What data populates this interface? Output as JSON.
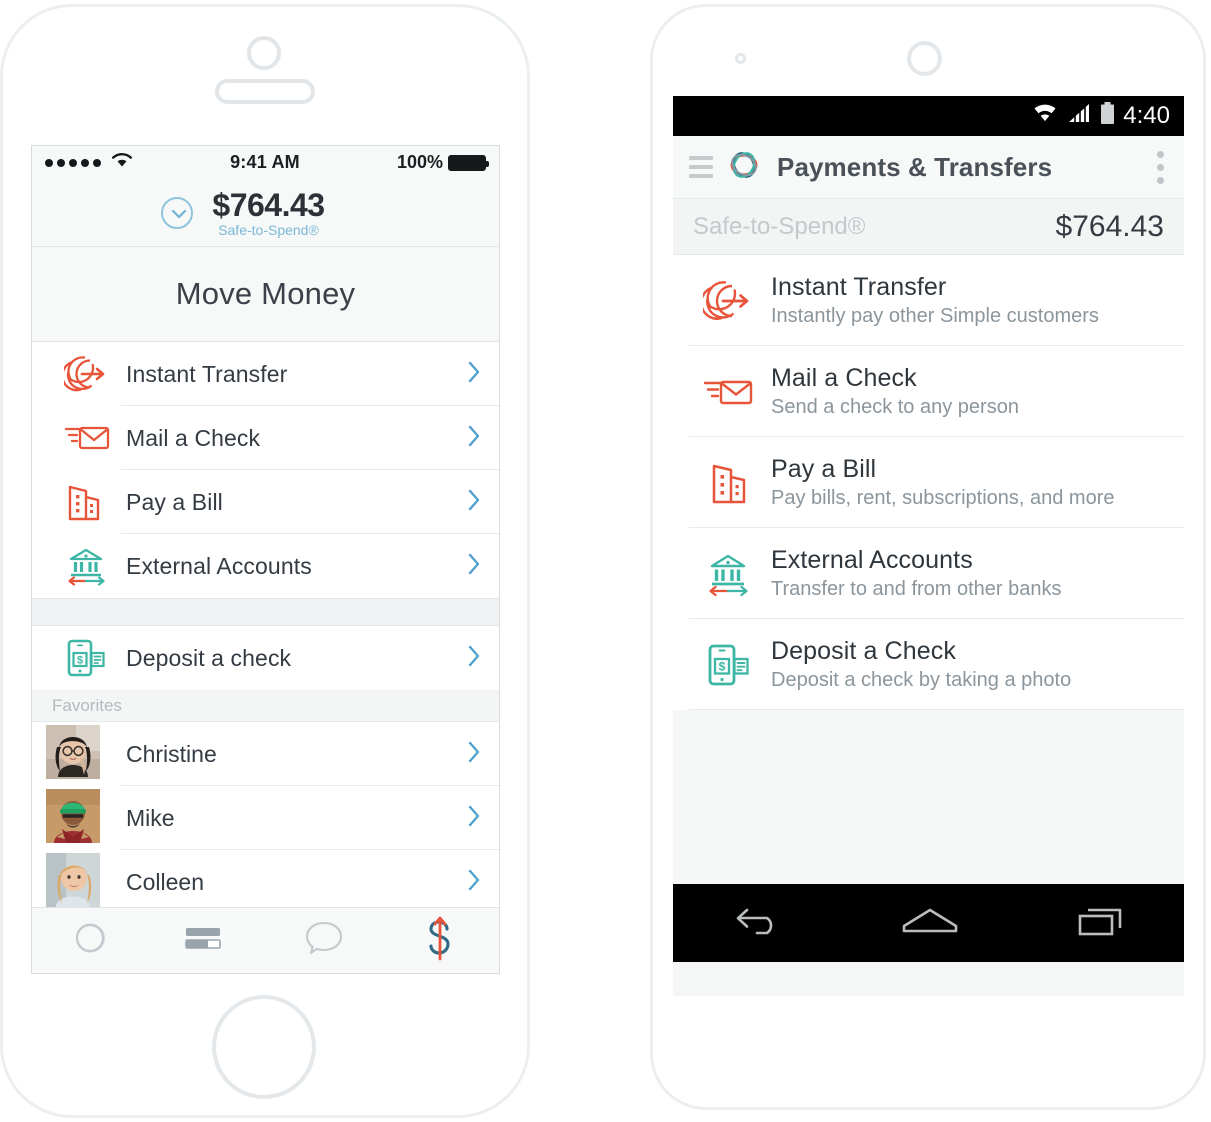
{
  "ios": {
    "status_bar": {
      "signal_dots": 5,
      "wifi_icon": "wifi-icon",
      "time": "9:41 AM",
      "battery_percent": "100%",
      "battery_icon": "battery-full-icon"
    },
    "safe_to_spend": {
      "amount": "$764.43",
      "label": "Safe-to-Spend®",
      "expand_icon": "chevron-down-circle-icon"
    },
    "nav_title": "Move Money",
    "primary_items": [
      {
        "label": "Instant Transfer",
        "icon": "instant-transfer-icon"
      },
      {
        "label": "Mail a Check",
        "icon": "envelope-icon"
      },
      {
        "label": "Pay a Bill",
        "icon": "buildings-icon"
      },
      {
        "label": "External Accounts",
        "icon": "bank-transfer-icon"
      }
    ],
    "secondary_items": [
      {
        "label": "Deposit a check",
        "icon": "phone-check-icon"
      }
    ],
    "favorites_header": "Favorites",
    "favorites": [
      {
        "name": "Christine",
        "avatar": "avatar-christine"
      },
      {
        "name": "Mike",
        "avatar": "avatar-mike"
      },
      {
        "name": "Colleen",
        "avatar": "avatar-colleen"
      }
    ],
    "tabs": [
      {
        "name": "home",
        "icon": "simple-logo-icon",
        "active": false
      },
      {
        "name": "goals",
        "icon": "goals-bars-icon",
        "active": false
      },
      {
        "name": "messages",
        "icon": "speech-bubble-icon",
        "active": false
      },
      {
        "name": "move-money",
        "icon": "dollar-arrow-icon",
        "active": true
      }
    ],
    "chevron_icon": "chevron-right-icon"
  },
  "android": {
    "status_bar": {
      "wifi_icon": "wifi-icon",
      "signal_icon": "cell-signal-icon",
      "battery_icon": "battery-icon",
      "time": "4:40"
    },
    "toolbar": {
      "menu_icon": "hamburger-menu-icon",
      "logo_icon": "simple-logo-icon",
      "title": "Payments & Transfers",
      "overflow_icon": "overflow-menu-icon"
    },
    "safe_to_spend": {
      "label": "Safe-to-Spend®",
      "amount": "$764.43"
    },
    "items": [
      {
        "title": "Instant Transfer",
        "subtitle": "Instantly pay other Simple customers",
        "icon": "instant-transfer-icon"
      },
      {
        "title": "Mail a Check",
        "subtitle": "Send a check to any person",
        "icon": "envelope-icon"
      },
      {
        "title": "Pay a Bill",
        "subtitle": "Pay bills, rent, subscriptions, and more",
        "icon": "buildings-icon"
      },
      {
        "title": "External Accounts",
        "subtitle": "Transfer to and from other banks",
        "icon": "bank-transfer-icon"
      },
      {
        "title": "Deposit a Check",
        "subtitle": "Deposit a check by taking a photo",
        "icon": "phone-check-icon"
      }
    ],
    "nav_bar": [
      {
        "name": "back",
        "icon": "back-arrow-icon"
      },
      {
        "name": "home",
        "icon": "home-icon"
      },
      {
        "name": "recents",
        "icon": "recents-icon"
      }
    ]
  },
  "colors": {
    "brand_orange": "#e8543a",
    "brand_teal": "#3eb6a5",
    "brand_blue": "#2e6a84",
    "accent_light_blue": "#7ab8d6",
    "chevron": "#4fa3cc",
    "text_dark": "#343b42",
    "text_muted": "#8b959c"
  }
}
